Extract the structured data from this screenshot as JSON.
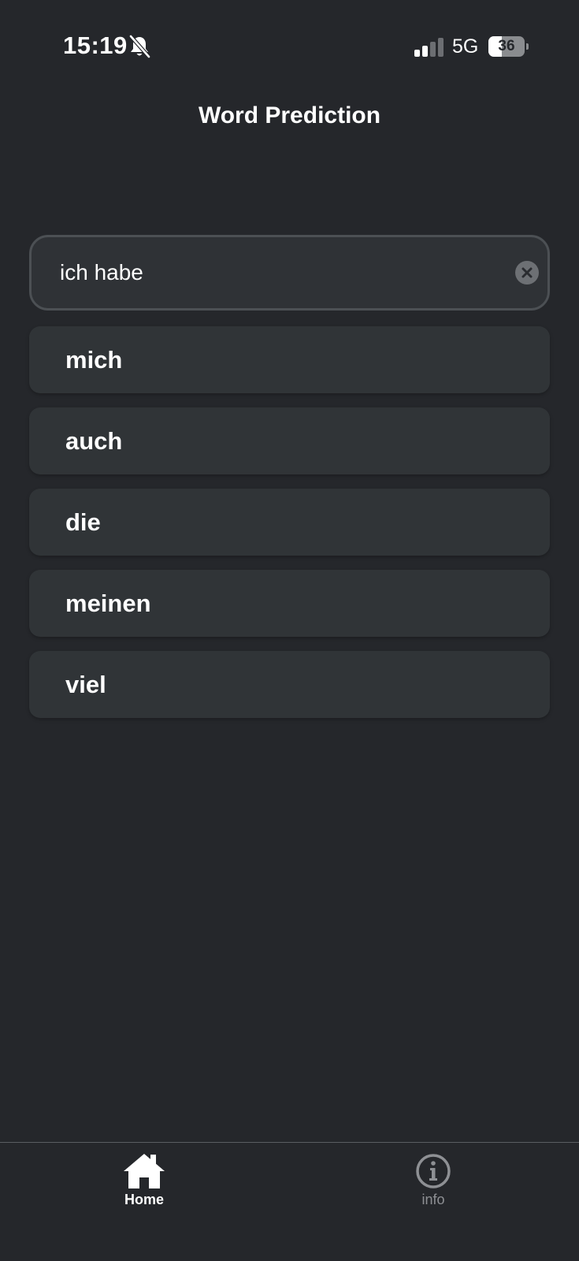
{
  "status_bar": {
    "time": "15:19",
    "network": "5G",
    "battery_level": "36",
    "battery_fraction": 0.36,
    "icons": [
      "bell-slash-icon",
      "signal-bars-icon",
      "battery-icon"
    ]
  },
  "header": {
    "title": "Word Prediction"
  },
  "search": {
    "value": "ich habe",
    "clear_icon": "close-circle-icon"
  },
  "suggestions": [
    {
      "label": "mich"
    },
    {
      "label": "auch"
    },
    {
      "label": "die"
    },
    {
      "label": "meinen"
    },
    {
      "label": "viel"
    }
  ],
  "tab_bar": {
    "tabs": [
      {
        "label": "Home",
        "icon": "home-icon",
        "active": true
      },
      {
        "label": "info",
        "icon": "info-icon",
        "active": false
      }
    ]
  },
  "colors": {
    "background": "#25272b",
    "surface": "#303437",
    "input_border": "#4c5054",
    "active_tab": "#ffffff",
    "inactive_tab": "#8e9094"
  }
}
